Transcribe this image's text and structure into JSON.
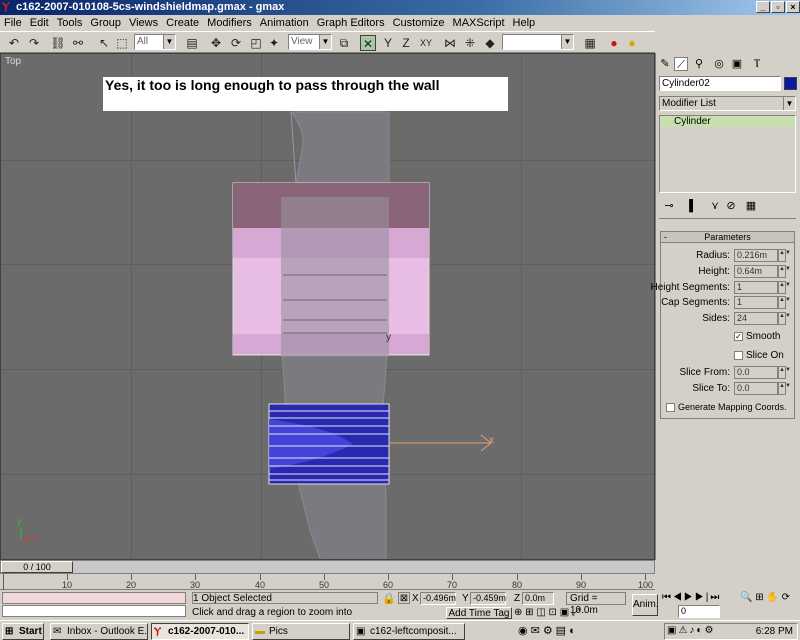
{
  "window": {
    "title": "c162-2007-010108-5cs-windshieldmap.gmax - gmax"
  },
  "menu": [
    "File",
    "Edit",
    "Tools",
    "Group",
    "Views",
    "Create",
    "Modifiers",
    "Animation",
    "Graph Editors",
    "Customize",
    "MAXScript",
    "Help"
  ],
  "toolbar": {
    "selection_filter": "All",
    "reference_coord": "View",
    "named_selection": ""
  },
  "viewport": {
    "label": "Top",
    "caption": "Yes, it too is long enough to pass through the wall",
    "axis_x": "x",
    "axis_y": "y",
    "gizmo_x": "x",
    "gizmo_y": "y"
  },
  "command_panel": {
    "object_name": "Cylinder02",
    "object_color": "#0a1aa0",
    "modifier_list": "Modifier List",
    "stack": [
      "Cylinder"
    ],
    "rollout_title": "Parameters",
    "params": [
      {
        "label": "Radius:",
        "value": "0.216m"
      },
      {
        "label": "Height:",
        "value": "0.64m"
      },
      {
        "label": "Height Segments:",
        "value": "1"
      },
      {
        "label": "Cap Segments:",
        "value": "1"
      },
      {
        "label": "Sides:",
        "value": "24"
      }
    ],
    "smooth_label": "Smooth",
    "slice_on_label": "Slice On",
    "slice_from_label": "Slice From:",
    "slice_from": "0.0",
    "slice_to_label": "Slice To:",
    "slice_to": "0.0",
    "mapping_label": "Generate Mapping Coords."
  },
  "timeline": {
    "frame": "0 / 100",
    "ticks": [
      "10",
      "20",
      "30",
      "40",
      "50",
      "60",
      "70",
      "80",
      "90",
      "100"
    ]
  },
  "status": {
    "selection": "1 Object Selected",
    "prompt": "Click and drag a region to zoom into",
    "x_label": "X",
    "x": "-0.496m",
    "y_label": "Y",
    "y": "-0.459m",
    "z_label": "Z",
    "z": "0.0m",
    "grid": "Grid = 10.0m",
    "add_time_tag": "Add Time Tag",
    "anim": "Anim.",
    "frame_field": "0"
  },
  "taskbar": {
    "start": "Start",
    "tasks": [
      "Inbox - Outlook E...",
      "c162-2007-010...",
      "Pics",
      "c162-leftcomposit..."
    ],
    "clock": "6:28 PM"
  },
  "colors": {
    "viewport_bg": "#6b6b6b",
    "cylinder_pink": "#f0c8ec",
    "cylinder_blue": "#2020c0",
    "panel_green": "#c8e0b0"
  }
}
